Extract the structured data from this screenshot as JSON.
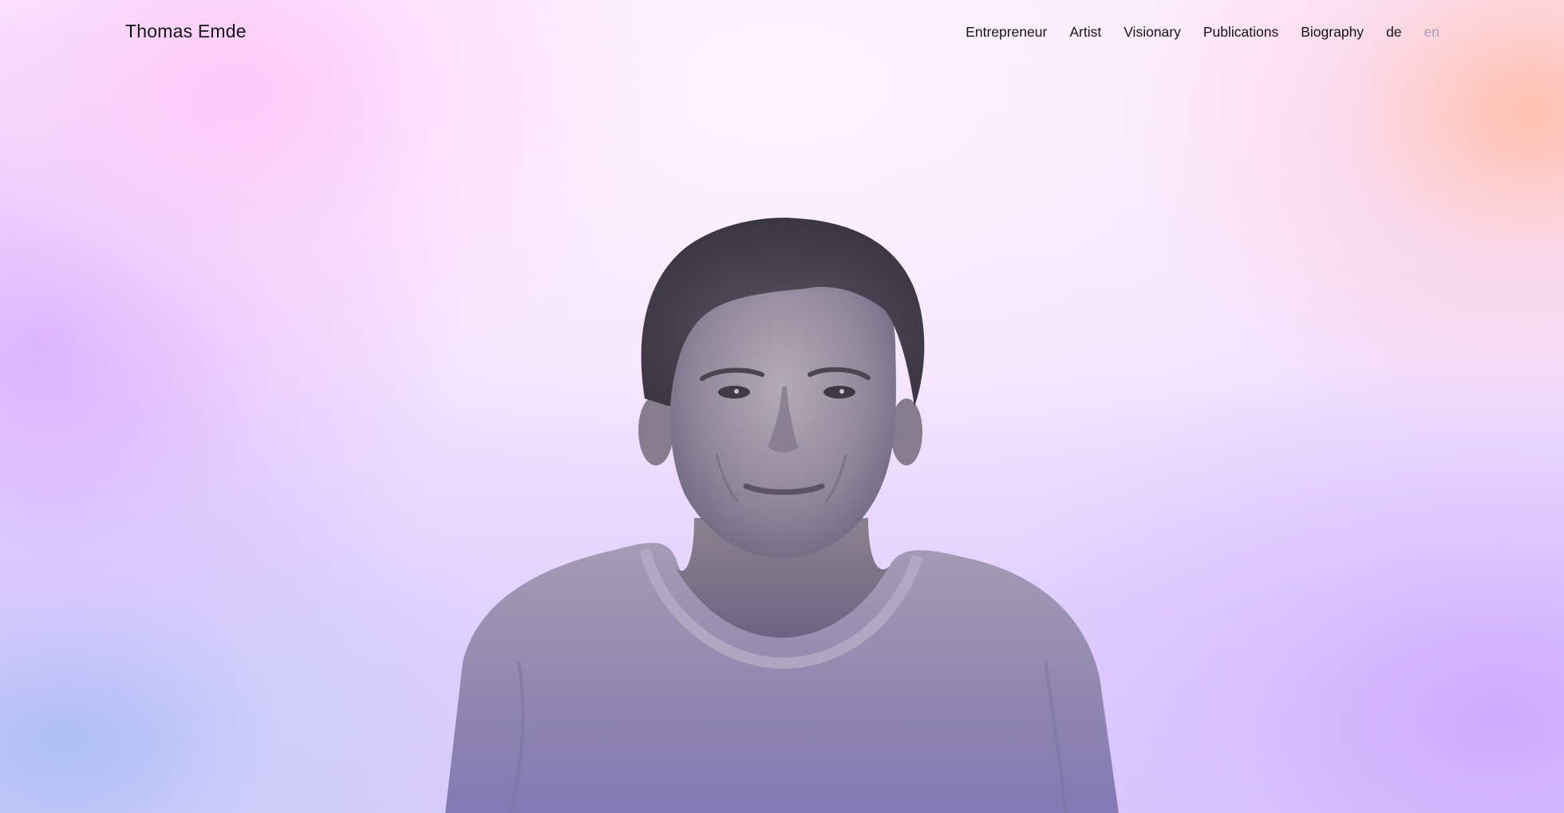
{
  "site": {
    "title": "Thomas Emde"
  },
  "nav": {
    "items": [
      {
        "label": "Entrepreneur"
      },
      {
        "label": "Artist"
      },
      {
        "label": "Visionary"
      },
      {
        "label": "Publications"
      },
      {
        "label": "Biography"
      }
    ],
    "languages": [
      {
        "label": "de",
        "active": true
      },
      {
        "label": "en",
        "active": false
      }
    ]
  },
  "hero": {
    "image": "portrait-photo",
    "colors": {
      "gradient_pink": "#ffc8fa",
      "gradient_peach": "#ffbeaa",
      "gradient_violet": "#d7aaff",
      "gradient_blue": "#aabef5",
      "text": "#141414",
      "muted_text": "#a9a0b6"
    }
  }
}
